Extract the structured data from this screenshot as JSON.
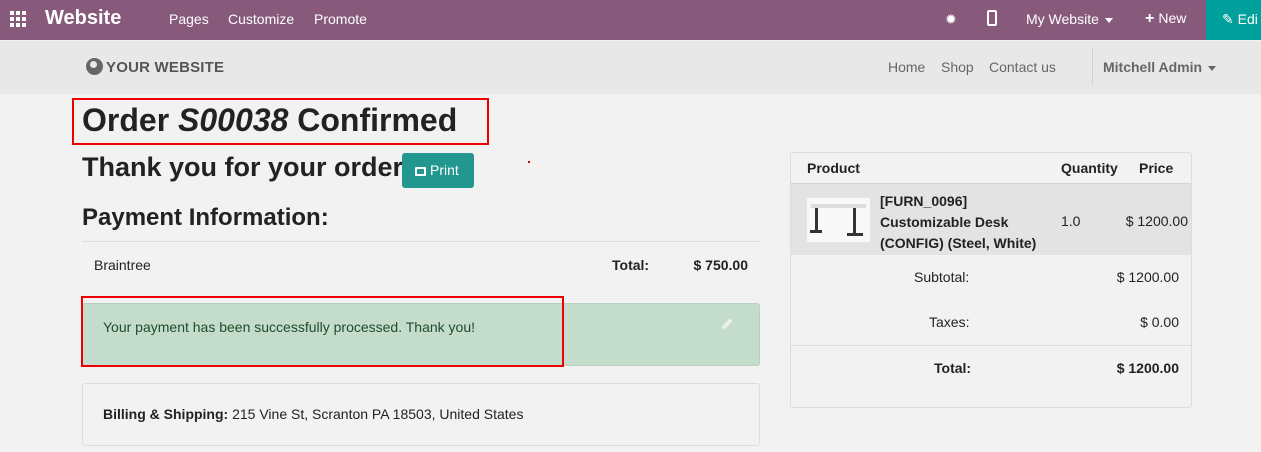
{
  "topbar": {
    "brand": "Website",
    "menu": [
      "Pages",
      "Customize",
      "Promote"
    ],
    "my_website": "My Website",
    "new": "New",
    "edit": "Edi",
    "icons": {
      "apps": "apps-grid-icon",
      "bug": "bug-icon",
      "mobile": "mobile-icon",
      "edit": "pencil-icon"
    }
  },
  "header": {
    "logo": "YOUR WEBSITE",
    "nav": [
      "Home",
      "Shop",
      "Contact us"
    ],
    "user": "Mitchell Admin"
  },
  "order": {
    "title_prefix": "Order",
    "number": "S00038",
    "title_suffix": "Confirmed",
    "thanks": "Thank you for your order.",
    "print": "Print"
  },
  "payment": {
    "heading": "Payment Information:",
    "method": "Braintree",
    "total_label": "Total:",
    "total_value": "$ 750.00",
    "success_message": "Your payment has been successfully processed. Thank you!"
  },
  "billing": {
    "label": "Billing & Shipping:",
    "address": "215 Vine St, Scranton PA 18503, United States"
  },
  "summary": {
    "headers": {
      "product": "Product",
      "quantity": "Quantity",
      "price": "Price"
    },
    "item": {
      "line1": "[FURN_0096]",
      "line2": "Customizable Desk",
      "line3": "(CONFIG) (Steel, White)",
      "quantity": "1.0",
      "price": "$ 1200.00"
    },
    "subtotal_label": "Subtotal:",
    "subtotal_value": "$ 1200.00",
    "taxes_label": "Taxes:",
    "taxes_value": "$ 0.00",
    "total_label": "Total:",
    "total_value": "$ 1200.00"
  },
  "colors": {
    "topbar": "#875a7b",
    "edit": "#00a09d",
    "print": "#21978f",
    "alert": "#c4dccb",
    "highlight": "#ee0000"
  }
}
